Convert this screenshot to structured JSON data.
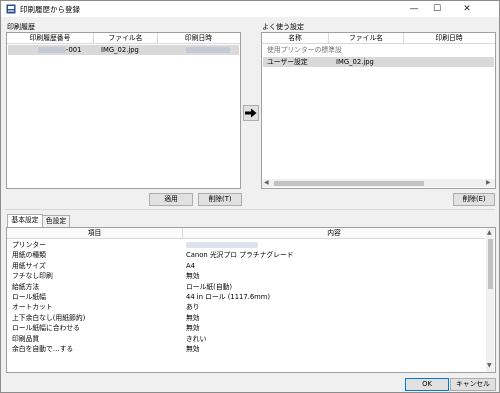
{
  "window": {
    "title": "印刷履歴から登録",
    "minimize_glyph": "—",
    "maximize_glyph": "☐",
    "close_glyph": "✕"
  },
  "history": {
    "label": "印刷履歴",
    "columns": [
      "印刷履歴番号",
      "ファイル名",
      "印刷日時"
    ],
    "rows": [
      {
        "number_suffix": "-001",
        "file": "IMG_02.jpg",
        "date": ""
      }
    ],
    "apply_button": "適用",
    "delete_button": "削除(T)"
  },
  "favorites": {
    "label": "よく使う設定",
    "columns": [
      "名称",
      "ファイル名",
      "印刷日時"
    ],
    "rows": [
      {
        "name": "使用プリンターの標準設",
        "file": "",
        "date": ""
      },
      {
        "name": "ユーザー設定",
        "file": "IMG_02.jpg",
        "date": ""
      }
    ],
    "delete_button": "削除(E)"
  },
  "transfer": {
    "arrow_icon": "right-arrow-icon"
  },
  "settings": {
    "tabs": [
      "基本設定",
      "色設定"
    ],
    "columns": [
      "項目",
      "内容"
    ],
    "rows": [
      {
        "item": "プリンター",
        "value": ""
      },
      {
        "item": "用紙の種類",
        "value": "Canon 光沢プロ プラチナグレード"
      },
      {
        "item": "用紙サイズ",
        "value": "A4"
      },
      {
        "item": "フチなし印刷",
        "value": "無効"
      },
      {
        "item": "給紙方法",
        "value": "ロール紙(自動)"
      },
      {
        "item": "ロール紙幅",
        "value": "44 in ロール (1117.6mm)"
      },
      {
        "item": "オートカット",
        "value": "あり"
      },
      {
        "item": "上下余白なし(用紙節約)",
        "value": "無効"
      },
      {
        "item": "ロール紙幅に合わせる",
        "value": "無効"
      },
      {
        "item": "印刷品質",
        "value": "きれい"
      },
      {
        "item": "余白を自動で…する",
        "value": "無効"
      }
    ]
  },
  "footer": {
    "ok": "OK",
    "cancel": "キャンセル"
  }
}
